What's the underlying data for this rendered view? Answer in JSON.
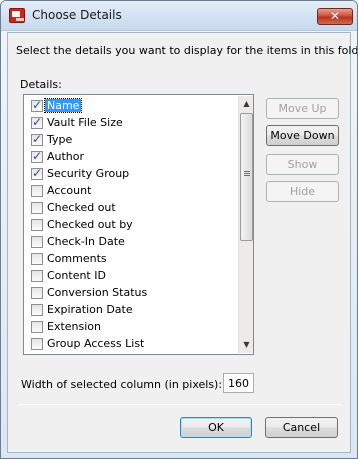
{
  "window": {
    "title": "Choose Details",
    "close_label": "✕"
  },
  "instructions": "Select the details you want to display for the items in this folder.",
  "details_label": "Details:",
  "details_list": [
    {
      "label": "Name",
      "checked": true,
      "selected": true
    },
    {
      "label": "Vault File Size",
      "checked": true,
      "selected": false
    },
    {
      "label": "Type",
      "checked": true,
      "selected": false
    },
    {
      "label": "Author",
      "checked": true,
      "selected": false
    },
    {
      "label": "Security Group",
      "checked": true,
      "selected": false
    },
    {
      "label": "Account",
      "checked": false,
      "selected": false
    },
    {
      "label": "Checked out",
      "checked": false,
      "selected": false
    },
    {
      "label": "Checked out by",
      "checked": false,
      "selected": false
    },
    {
      "label": "Check-In Date",
      "checked": false,
      "selected": false
    },
    {
      "label": "Comments",
      "checked": false,
      "selected": false
    },
    {
      "label": "Content ID",
      "checked": false,
      "selected": false
    },
    {
      "label": "Conversion Status",
      "checked": false,
      "selected": false
    },
    {
      "label": "Expiration Date",
      "checked": false,
      "selected": false
    },
    {
      "label": "Extension",
      "checked": false,
      "selected": false
    },
    {
      "label": "Group Access List",
      "checked": false,
      "selected": false
    }
  ],
  "buttons": {
    "move_up": {
      "label": "Move Up",
      "enabled": false
    },
    "move_down": {
      "label": "Move Down",
      "enabled": true
    },
    "show": {
      "label": "Show",
      "enabled": false
    },
    "hide": {
      "label": "Hide",
      "enabled": false
    },
    "ok": {
      "label": "OK"
    },
    "cancel": {
      "label": "Cancel"
    }
  },
  "column_width": {
    "label": "Width of selected column (in pixels):",
    "value": "160"
  },
  "scrollbar": {
    "up_arrow": "▲",
    "down_arrow": "▼"
  },
  "colors": {
    "selection": "#3399ff",
    "close_button": "#c9452e",
    "title_bar": "#d4e2f2"
  }
}
